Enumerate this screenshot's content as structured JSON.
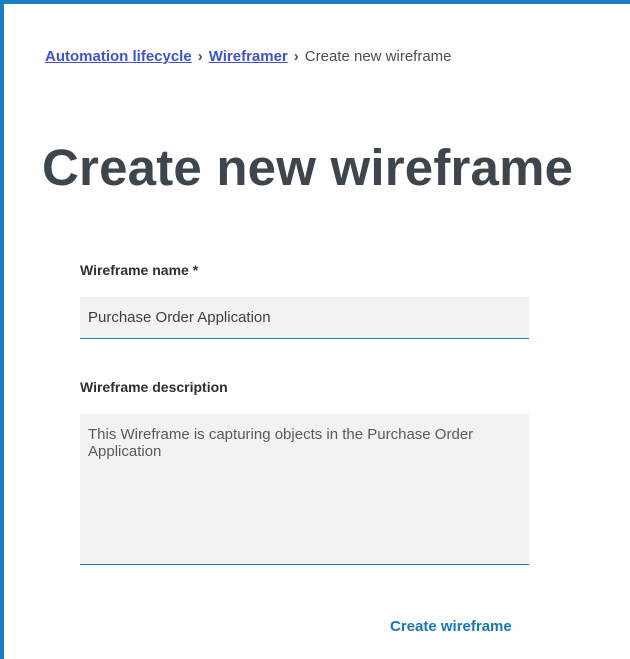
{
  "breadcrumb": {
    "items": [
      {
        "label": "Automation lifecycle",
        "link": true
      },
      {
        "label": "Wireframer",
        "link": true
      },
      {
        "label": "Create new wireframe",
        "link": false
      }
    ],
    "separator": "›"
  },
  "page": {
    "title": "Create new wireframe"
  },
  "form": {
    "name_label": "Wireframe name *",
    "name_value": "Purchase Order Application",
    "description_label": "Wireframe description",
    "description_value": "This Wireframe is capturing objects in the Purchase Order Application"
  },
  "actions": {
    "create_label": "Create wireframe"
  },
  "colors": {
    "accent": "#1b7ec2",
    "link": "#3d55c8",
    "title": "#3e454c",
    "field_bg": "#f2f2f2"
  }
}
